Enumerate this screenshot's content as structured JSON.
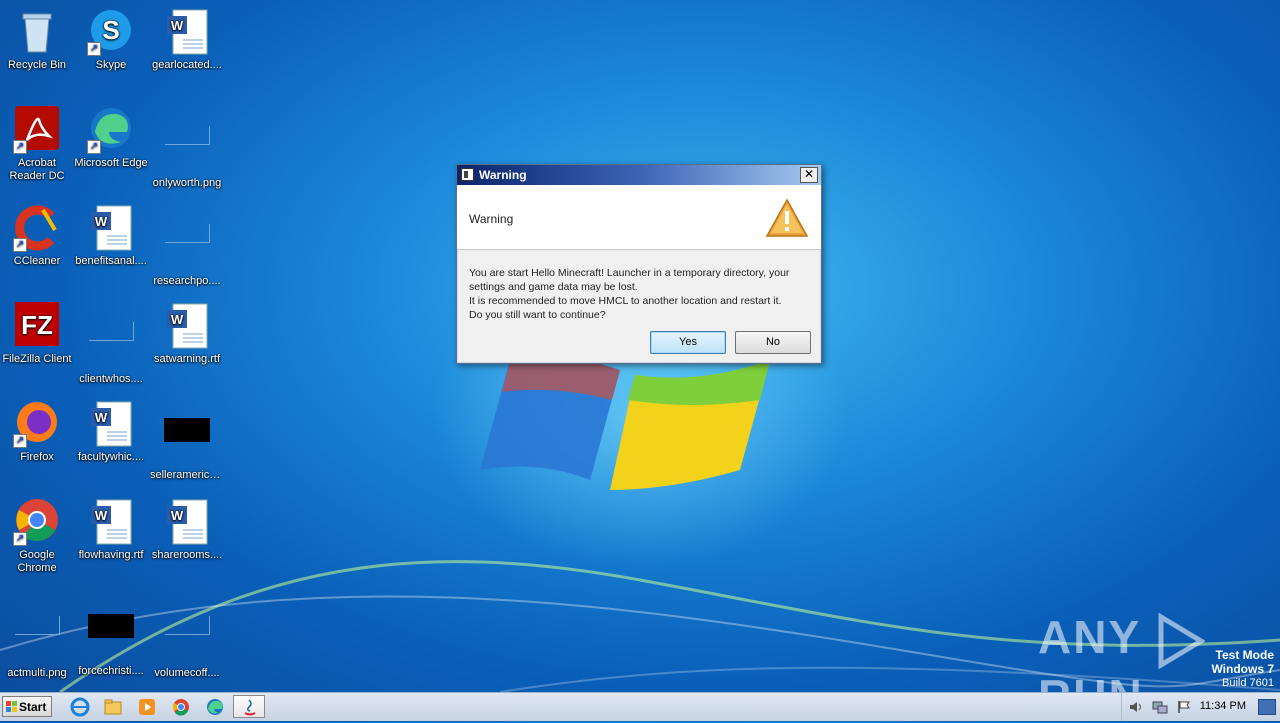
{
  "desktop": {
    "icons": [
      {
        "id": "recycle-bin",
        "label": "Recycle Bin"
      },
      {
        "id": "skype",
        "label": "Skype"
      },
      {
        "id": "gearlocated",
        "label": "gearlocated...."
      },
      {
        "id": "acrobat",
        "label": "Acrobat Reader DC"
      },
      {
        "id": "edge",
        "label": "Microsoft Edge"
      },
      {
        "id": "onlyworth",
        "label": "onlyworth.png"
      },
      {
        "id": "ccleaner",
        "label": "CCleaner"
      },
      {
        "id": "benefitsanal",
        "label": "benefitsanal...."
      },
      {
        "id": "researchpo",
        "label": "researchpo...."
      },
      {
        "id": "filezilla",
        "label": "FileZilla Client"
      },
      {
        "id": "clientwhos",
        "label": "clientwhos...."
      },
      {
        "id": "satwarning",
        "label": "satwarning.rtf"
      },
      {
        "id": "firefox",
        "label": "Firefox"
      },
      {
        "id": "facultywhic",
        "label": "facultywhic...."
      },
      {
        "id": "selleramerica",
        "label": "selleramerica...."
      },
      {
        "id": "chrome",
        "label": "Google Chrome"
      },
      {
        "id": "flowhaving",
        "label": "flowhaving.rtf"
      },
      {
        "id": "sharerooms",
        "label": "sharerooms...."
      },
      {
        "id": "actmulti",
        "label": "actmulti.png"
      },
      {
        "id": "forcechristi",
        "label": "forcechristi...."
      },
      {
        "id": "volumecoff",
        "label": "volumecoff...."
      }
    ]
  },
  "dialog": {
    "title": "Warning",
    "header": "Warning",
    "message_lines": [
      "You are start Hello Minecraft! Launcher in a temporary directory, your",
      "settings and game data may be lost.",
      "It is recommended to move HMCL to another location and restart it.",
      "Do you still want to continue?"
    ],
    "yes_label": "Yes",
    "no_label": "No",
    "close_glyph": "✕"
  },
  "watermark": {
    "any": "ANY",
    "run": "RUN",
    "test_mode": "Test Mode",
    "os": "Windows 7",
    "build": "Build 7601"
  },
  "taskbar": {
    "start_label": "Start",
    "clock": "11:34 PM"
  },
  "colors": {
    "accent": "#3c7fb1",
    "title_start": "#0b246a",
    "title_end": "#a6caf0",
    "warning": "#e8a23a"
  }
}
